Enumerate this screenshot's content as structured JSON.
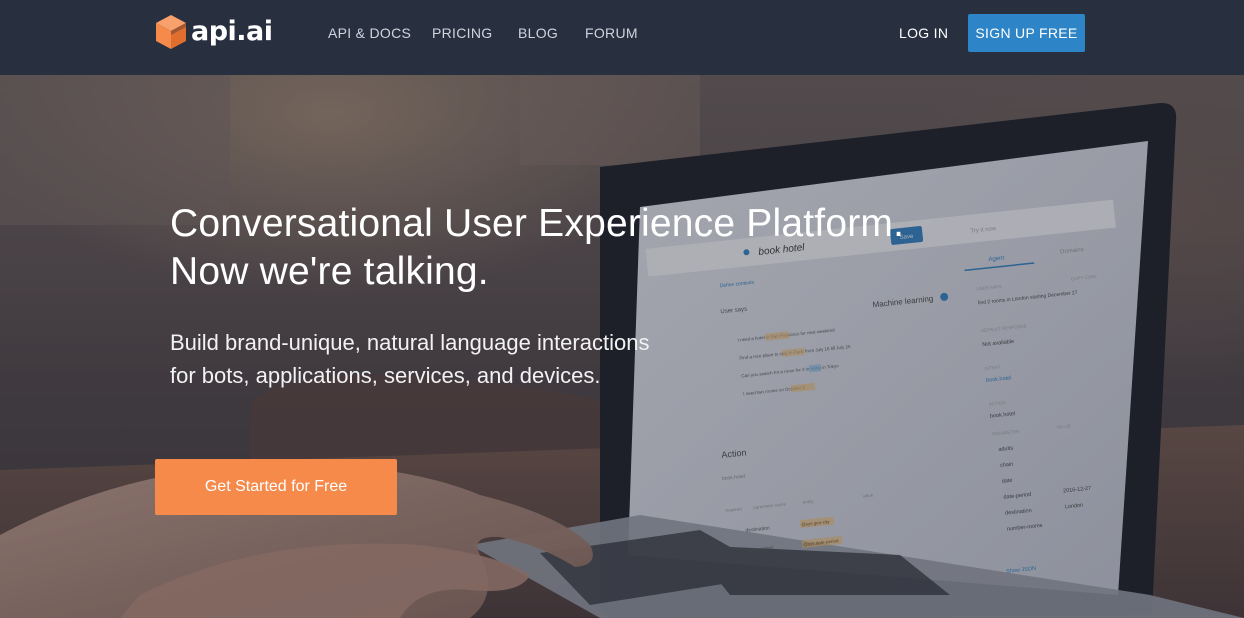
{
  "brand": {
    "name": "api.ai",
    "logo_color": "#f58a4b"
  },
  "nav": {
    "links": [
      {
        "label": "API & DOCS"
      },
      {
        "label": "PRICING"
      },
      {
        "label": "BLOG"
      },
      {
        "label": "FORUM"
      }
    ],
    "login_label": "LOG IN",
    "signup_label": "SIGN UP FREE",
    "signup_color": "#2d84c6"
  },
  "hero": {
    "headline_line1": "Conversational User Experience Platform.",
    "headline_line2": "Now we're talking.",
    "subhead_line1": "Build brand-unique, natural language interactions",
    "subhead_line2": "for bots, applications, services, and devices.",
    "cta_label": "Get Started for Free",
    "cta_color": "#f58a4b"
  },
  "laptop_screen": {
    "intent_title": "book hotel",
    "save_label": "Save",
    "try_placeholder": "Try it now",
    "tabs": [
      "Agent",
      "Domains"
    ],
    "machine_learning_label": "Machine learning",
    "section_label": "Define contexts",
    "user_says_label": "User says",
    "examples": [
      "I need a hotel in San Francisco for next weekend",
      "Find a nice place to stay in Paris from July 16 till July 25",
      "Can you search for a room for 2 in Hotel in Tokyo",
      "I need two rooms on October 3"
    ],
    "action_heading": "Action",
    "action_placeholder": "book.hotel",
    "params_header": [
      "required",
      "parameter name",
      "entity",
      "value"
    ],
    "param_rows": [
      {
        "name": "destination",
        "entity": "@sys.geo-city"
      },
      {
        "name": "date-period",
        "entity": "@sys.date-period"
      }
    ],
    "right_panel": {
      "user_says_label": "USER SAYS",
      "copy_curl": "COPY CURL",
      "query": "find 2 rooms in London starting December 27",
      "default_response_label": "DEFAULT RESPONSE",
      "default_response": "Not available",
      "intent_label": "INTENT",
      "intent": "book.hotel",
      "action_label": "ACTION",
      "action": "book.hotel",
      "parameter_label": "PARAMETER",
      "value_label": "VALUE",
      "params": [
        "adults",
        "chain",
        "date",
        "date-period",
        "destination",
        "number-rooms"
      ],
      "values": [
        "",
        "",
        "",
        "2016-12-27",
        "London",
        ""
      ],
      "show_json": "Show JSON"
    }
  }
}
